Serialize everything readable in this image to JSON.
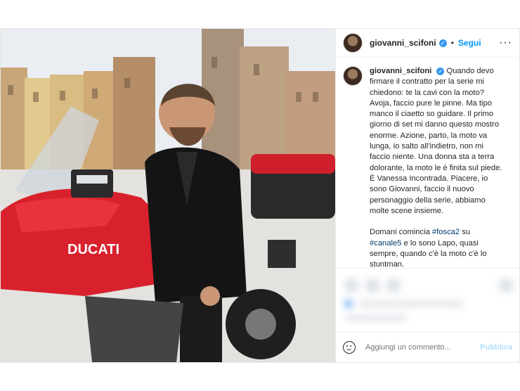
{
  "post": {
    "username": "giovanni_scifoni",
    "separator": "•",
    "follow_label": "Segui",
    "more_label": "···",
    "verified_mark": "✓",
    "caption_parts": [
      "Quando devo firmare il contratto per la serie mi chiedono: te la cavi con la moto? Avoja, faccio pure le pinne. Ma tipo manco il ciaetto so guidare. Il primo giorno di set mi danno questo mostro enorme. Azione, parto, la moto va lunga, io salto all'indietro, non mi faccio niente. Una donna sta a terra dolorante, la moto le è finita sul piede. È Vanessa Incontrada. Piacere, io sono Giovanni, faccio il nuovo personaggio della serie, abbiamo molte scene insieme.",
      "Domani comincia",
      "#fosca2",
      "su",
      "#canale5",
      "e lo sono Lapo, quasi sempre, quando c'è la moto c'è lo stuntman."
    ],
    "comment_placeholder": "Aggiungi un commento...",
    "publish_label": "Pubblica"
  },
  "photo": {
    "bike_brand": "DUCATI",
    "colors": {
      "bike": "#d8212d",
      "jacket": "#141414",
      "sky": "#e9eef2",
      "link": "#0095f6"
    }
  }
}
